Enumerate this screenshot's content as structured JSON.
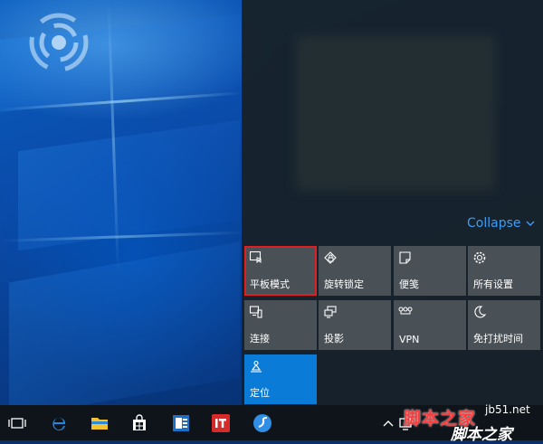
{
  "action_center": {
    "collapse_label": "Collapse",
    "tiles": [
      {
        "label": "平板模式",
        "icon": "tablet-mode-icon",
        "state": "highlighted"
      },
      {
        "label": "旋转锁定",
        "icon": "rotation-lock-icon",
        "state": "off"
      },
      {
        "label": "便笺",
        "icon": "note-icon",
        "state": "off"
      },
      {
        "label": "所有设置",
        "icon": "gear-icon",
        "state": "off"
      },
      {
        "label": "连接",
        "icon": "connect-icon",
        "state": "off"
      },
      {
        "label": "投影",
        "icon": "project-icon",
        "state": "off"
      },
      {
        "label": "VPN",
        "icon": "vpn-icon",
        "state": "off"
      },
      {
        "label": "免打扰时间",
        "icon": "moon-icon",
        "state": "off"
      },
      {
        "label": "定位",
        "icon": "location-icon",
        "state": "on"
      }
    ]
  },
  "taskbar": {
    "icons": [
      "task-view-icon",
      "edge-icon",
      "file-explorer-icon",
      "store-icon",
      "outlook-icon",
      "ithome-app-icon",
      "browser-app-icon",
      "chevron-up-icon",
      "network-icon"
    ]
  },
  "watermark": {
    "line1": "脚本之家",
    "site": "jb51.net",
    "brand": "脚本之家"
  },
  "colors": {
    "accent": "#0a7bd6",
    "highlight": "#e02020",
    "tile": "#4a5156",
    "link": "#3f9cf2"
  }
}
